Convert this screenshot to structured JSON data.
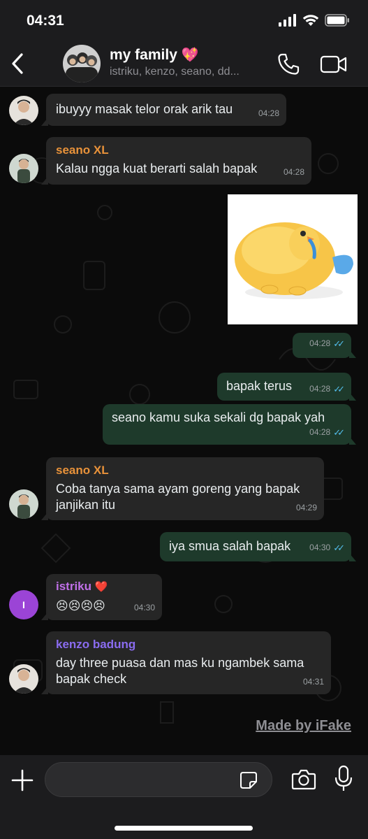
{
  "status_bar": {
    "time": "04:31"
  },
  "header": {
    "title": "my family",
    "title_emoji": "💖",
    "members": "istriku, kenzo, seano, dd..."
  },
  "messages": [
    {
      "text": "ibuyyy masak telor orak arik tau",
      "time": "04:28"
    },
    {
      "sender": "seano XL",
      "text": "Kalau ngga kuat berarti salah bapak",
      "time": "04:28"
    },
    {
      "sticker": "crying-chick-sticker",
      "time": "04:28"
    },
    {
      "text": "bapak terus",
      "time": "04:28"
    },
    {
      "text": "seano kamu suka sekali dg bapak yah",
      "time": "04:28"
    },
    {
      "sender": "seano XL",
      "text": "Coba tanya sama ayam goreng yang bapak janjikan itu",
      "time": "04:29"
    },
    {
      "text": "iya smua salah bapak",
      "time": "04:30"
    },
    {
      "sender": "istriku",
      "sender_emoji": "❤️",
      "text": "😣😣😣😣",
      "time": "04:30",
      "avatar_letter": "I"
    },
    {
      "sender": "kenzo badung",
      "text": "day three puasa dan mas ku ngambek sama bapak check",
      "time": "04:31"
    }
  ],
  "watermark": "Made by iFake",
  "colors": {
    "seano": "#e8923a",
    "istriku": "#c070e8",
    "kenzo": "#8a6cf0",
    "read_ticks": "#53bdeb",
    "outgoing_bubble": "#1e3a2b",
    "incoming_bubble": "#262626"
  },
  "icons": [
    "back-chevron-icon",
    "phone-icon",
    "video-camera-icon",
    "plus-icon",
    "sticker-icon",
    "camera-icon",
    "microphone-icon"
  ]
}
